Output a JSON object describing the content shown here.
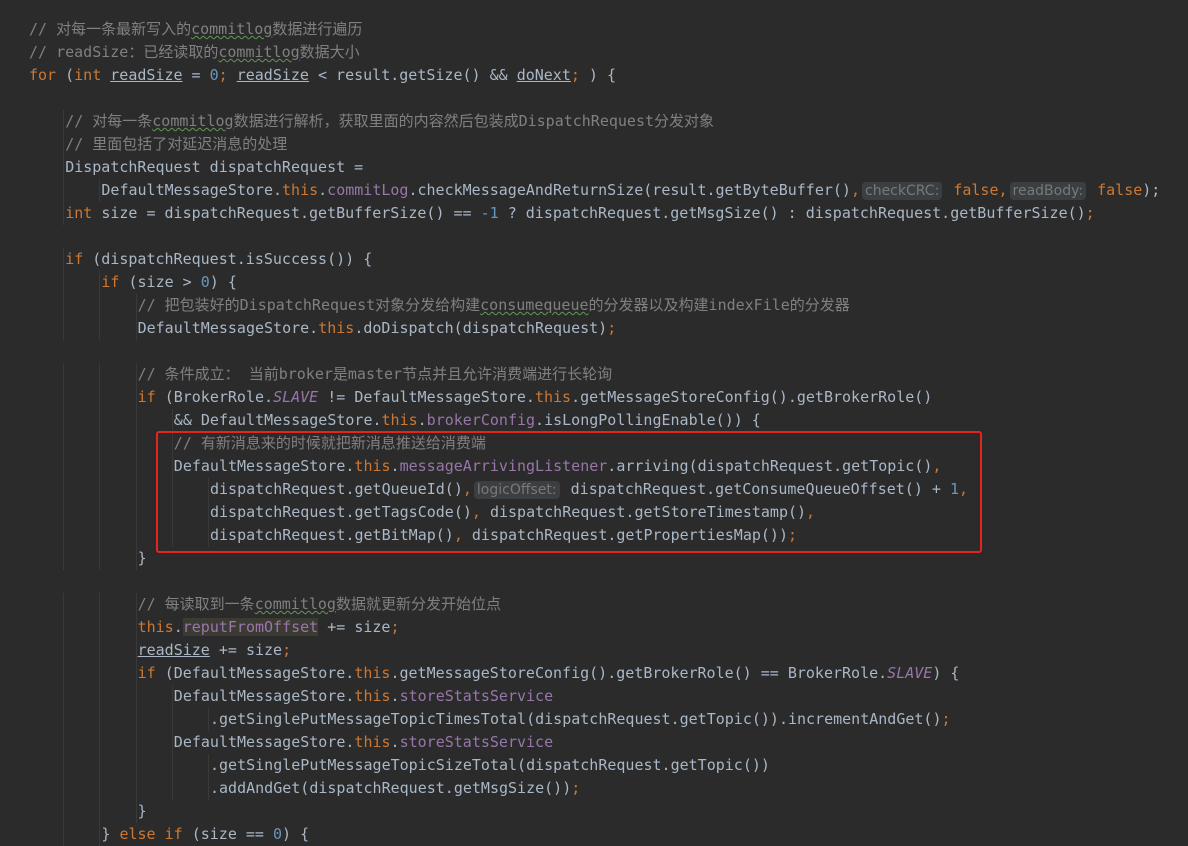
{
  "code_lines": [
    [
      [
        "c",
        "// 对每一条最新写入的"
      ],
      [
        "cw",
        "commitlog"
      ],
      [
        "c",
        "数据进行遍历"
      ]
    ],
    [
      [
        "c",
        "// readSize："
      ],
      [
        "c",
        "已经读取的"
      ],
      [
        "cw",
        "commitlog"
      ],
      [
        "c",
        "数据大小"
      ]
    ],
    [
      [
        "k",
        "for"
      ],
      [
        "t",
        " ("
      ],
      [
        "k",
        "int "
      ],
      [
        "u",
        "readSize"
      ],
      [
        "t",
        " = "
      ],
      [
        "n",
        "0"
      ],
      [
        "k",
        ";"
      ],
      [
        "t",
        " "
      ],
      [
        "u",
        "readSize"
      ],
      [
        "t",
        " < result.getSize() && "
      ],
      [
        "u",
        "doNext"
      ],
      [
        "k",
        ";"
      ],
      [
        "t",
        " ) {"
      ]
    ],
    [],
    [
      [
        "c",
        "// 对每一条"
      ],
      [
        "cw",
        "commitlog"
      ],
      [
        "c",
        "数据进行解析，获取里面的内容然后包装成DispatchRequest分发对象"
      ]
    ],
    [
      [
        "c",
        "// 里面包括了对延迟消息的处理"
      ]
    ],
    [
      [
        "t",
        "DispatchRequest dispatchRequest ="
      ]
    ],
    [
      [
        "t",
        "DefaultMessageStore."
      ],
      [
        "k",
        "this"
      ],
      [
        "t",
        "."
      ],
      [
        "f",
        "commitLog"
      ],
      [
        "t",
        ".checkMessageAndReturnSize(result.getByteBuffer()"
      ],
      [
        "k",
        ","
      ],
      [
        "h",
        "checkCRC:"
      ],
      [
        "k",
        " false,"
      ],
      [
        "h",
        "readBody:"
      ],
      [
        "k",
        " false"
      ],
      [
        "t",
        ");"
      ]
    ],
    [
      [
        "k",
        "int "
      ],
      [
        "t",
        "size = dispatchRequest.getBufferSize() == "
      ],
      [
        "n",
        "-1"
      ],
      [
        "t",
        " ? dispatchRequest.getMsgSize() : dispatchRequest.getBufferSize()"
      ],
      [
        "k",
        ";"
      ]
    ],
    [],
    [
      [
        "k",
        "if "
      ],
      [
        "t",
        "(dispatchRequest.isSuccess()) {"
      ]
    ],
    [
      [
        "k",
        "if "
      ],
      [
        "t",
        "(size > "
      ],
      [
        "n",
        "0"
      ],
      [
        "t",
        ") {"
      ]
    ],
    [
      [
        "c",
        "// 把包装好的DispatchRequest对象分发给构建"
      ],
      [
        "cw",
        "consumequeue"
      ],
      [
        "c",
        "的分发器以及构建indexFile的分发器"
      ]
    ],
    [
      [
        "t",
        "DefaultMessageStore."
      ],
      [
        "k",
        "this"
      ],
      [
        "t",
        ".doDispatch(dispatchRequest)"
      ],
      [
        "k",
        ";"
      ]
    ],
    [],
    [
      [
        "c",
        "// 条件成立： 当前broker是master节点并且允许消费端进行长轮询"
      ]
    ],
    [
      [
        "k",
        "if "
      ],
      [
        "t",
        "(BrokerRole."
      ],
      [
        "fi",
        "SLAVE"
      ],
      [
        "t",
        " != DefaultMessageStore."
      ],
      [
        "k",
        "this"
      ],
      [
        "t",
        ".getMessageStoreConfig().getBrokerRole()"
      ]
    ],
    [
      [
        "t",
        "&& DefaultMessageStore."
      ],
      [
        "k",
        "this"
      ],
      [
        "t",
        "."
      ],
      [
        "f",
        "brokerConfig"
      ],
      [
        "t",
        ".isLongPollingEnable()) {"
      ]
    ],
    [
      [
        "c",
        "// 有新消息来的时候就把新消息推送给消费端"
      ]
    ],
    [
      [
        "t",
        "DefaultMessageStore."
      ],
      [
        "k",
        "this"
      ],
      [
        "t",
        "."
      ],
      [
        "f",
        "messageArrivingListener"
      ],
      [
        "t",
        ".arriving(dispatchRequest.getTopic()"
      ],
      [
        "k",
        ","
      ]
    ],
    [
      [
        "t",
        "dispatchRequest.getQueueId()"
      ],
      [
        "k",
        ","
      ],
      [
        "h",
        "logicOffset:"
      ],
      [
        "t",
        " dispatchRequest.getConsumeQueueOffset() + "
      ],
      [
        "n",
        "1"
      ],
      [
        "k",
        ","
      ]
    ],
    [
      [
        "t",
        "dispatchRequest.getTagsCode()"
      ],
      [
        "k",
        ","
      ],
      [
        "t",
        " dispatchRequest.getStoreTimestamp()"
      ],
      [
        "k",
        ","
      ]
    ],
    [
      [
        "t",
        "dispatchRequest.getBitMap()"
      ],
      [
        "k",
        ","
      ],
      [
        "t",
        " dispatchRequest.getPropertiesMap())"
      ],
      [
        "k",
        ";"
      ]
    ],
    [
      [
        "t",
        "}"
      ]
    ],
    [],
    [
      [
        "c",
        "// 每读取到一条"
      ],
      [
        "cw",
        "commitlog"
      ],
      [
        "c",
        "数据就更新分发开始位点"
      ]
    ],
    [
      [
        "k",
        "this"
      ],
      [
        "t",
        "."
      ],
      [
        "fh",
        "reputFromOffset"
      ],
      [
        "t",
        " += size"
      ],
      [
        "k",
        ";"
      ]
    ],
    [
      [
        "u",
        "readSize"
      ],
      [
        "t",
        " += size"
      ],
      [
        "k",
        ";"
      ]
    ],
    [
      [
        "k",
        "if "
      ],
      [
        "t",
        "(DefaultMessageStore."
      ],
      [
        "k",
        "this"
      ],
      [
        "t",
        ".getMessageStoreConfig().getBrokerRole() == BrokerRole."
      ],
      [
        "fi",
        "SLAVE"
      ],
      [
        "t",
        ") {"
      ]
    ],
    [
      [
        "t",
        "DefaultMessageStore."
      ],
      [
        "k",
        "this"
      ],
      [
        "t",
        "."
      ],
      [
        "f",
        "storeStatsService"
      ]
    ],
    [
      [
        "t",
        ".getSinglePutMessageTopicTimesTotal(dispatchRequest.getTopic()).incrementAndGet()"
      ],
      [
        "k",
        ";"
      ]
    ],
    [
      [
        "t",
        "DefaultMessageStore."
      ],
      [
        "k",
        "this"
      ],
      [
        "t",
        "."
      ],
      [
        "f",
        "storeStatsService"
      ]
    ],
    [
      [
        "t",
        ".getSinglePutMessageTopicSizeTotal(dispatchRequest.getTopic())"
      ]
    ],
    [
      [
        "t",
        ".addAndGet(dispatchRequest.getMsgSize())"
      ],
      [
        "k",
        ";"
      ]
    ],
    [
      [
        "t",
        "}"
      ]
    ],
    [
      [
        "t",
        "} "
      ],
      [
        "k",
        "else if "
      ],
      [
        "t",
        "(size == "
      ],
      [
        "n",
        "0"
      ],
      [
        "t",
        ") {"
      ]
    ]
  ]
}
